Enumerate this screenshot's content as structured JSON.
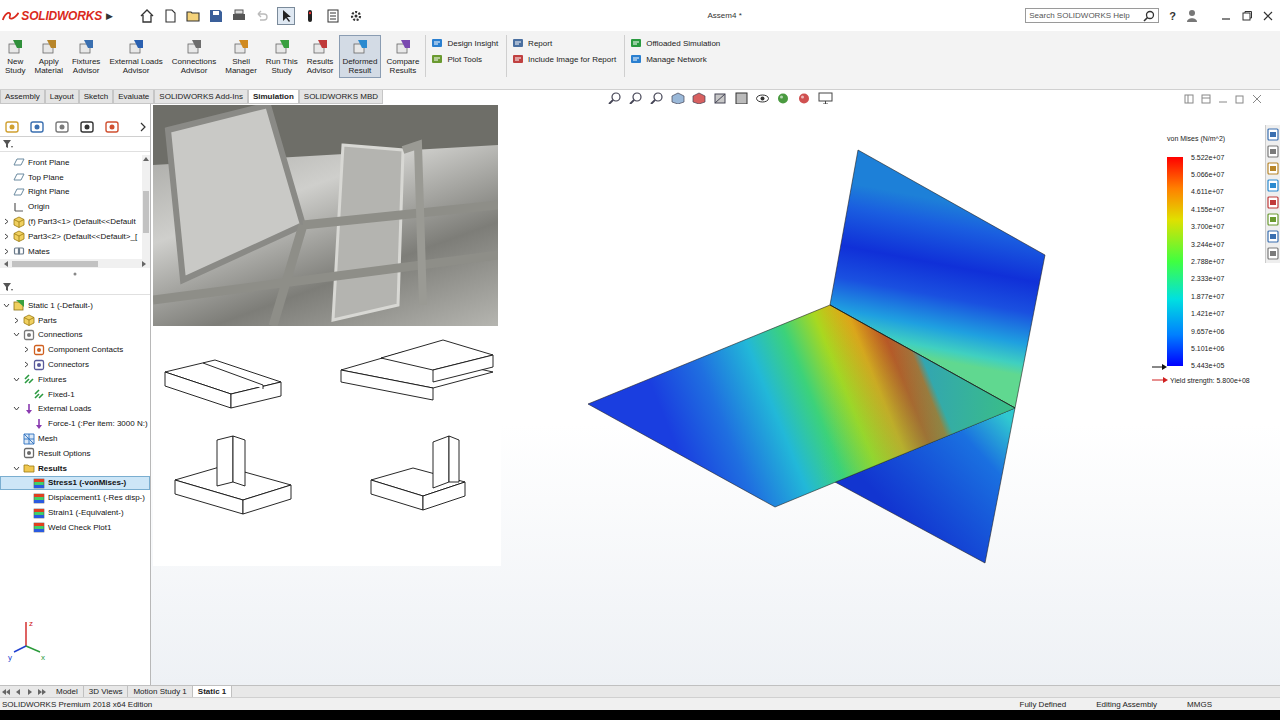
{
  "app": {
    "logo": "SOLIDWORKS",
    "menu_arrow": "▶",
    "title": "Assem4 *",
    "search": {
      "placeholder": "Search SOLIDWORKS Help"
    },
    "help": "?"
  },
  "ribbon": {
    "large_buttons": [
      {
        "lines": [
          "New",
          "Study"
        ],
        "selected": false
      },
      {
        "lines": [
          "Apply",
          "Material"
        ],
        "selected": false
      },
      {
        "lines": [
          "Fixtures",
          "Advisor"
        ],
        "selected": false
      },
      {
        "lines": [
          "External Loads",
          "Advisor"
        ],
        "selected": false
      },
      {
        "lines": [
          "Connections",
          "Advisor"
        ],
        "selected": false
      },
      {
        "lines": [
          "Shell",
          "Manager"
        ],
        "selected": false
      },
      {
        "lines": [
          "Run This",
          "Study"
        ],
        "selected": false
      },
      {
        "lines": [
          "Results",
          "Advisor"
        ],
        "selected": false
      },
      {
        "lines": [
          "Deformed",
          "Result"
        ],
        "selected": true
      },
      {
        "lines": [
          "Compare",
          "Results"
        ],
        "selected": false
      }
    ],
    "small_groups": [
      [
        "Design Insight",
        "Plot Tools"
      ],
      [
        "Report",
        "Include Image for Report"
      ],
      [
        "Offloaded Simulation",
        "Manage Network"
      ]
    ]
  },
  "tabs": [
    {
      "label": "Assembly",
      "selected": false
    },
    {
      "label": "Layout",
      "selected": false
    },
    {
      "label": "Sketch",
      "selected": false
    },
    {
      "label": "Evaluate",
      "selected": false
    },
    {
      "label": "SOLIDWORKS Add-Ins",
      "selected": false
    },
    {
      "label": "Simulation",
      "selected": true
    },
    {
      "label": "SOLIDWORKS MBD",
      "selected": false
    }
  ],
  "feature_tree": [
    {
      "label": "Front Plane",
      "kind": "plane",
      "expandable": false,
      "expanded": false
    },
    {
      "label": "Top Plane",
      "kind": "plane",
      "expandable": false,
      "expanded": false
    },
    {
      "label": "Right Plane",
      "kind": "plane",
      "expandable": false,
      "expanded": false
    },
    {
      "label": "Origin",
      "kind": "origin",
      "expandable": false,
      "expanded": false
    },
    {
      "label": "(f) Part3<1> (Default<<Default",
      "kind": "part",
      "expandable": true,
      "expanded": false
    },
    {
      "label": "Part3<2> (Default<<Default>_[",
      "kind": "part",
      "expandable": true,
      "expanded": false
    },
    {
      "label": "Mates",
      "kind": "mates",
      "expandable": true,
      "expanded": false
    }
  ],
  "sim_tree": [
    {
      "label": "Static 1 (-Default-)",
      "level": 0,
      "kind": "study",
      "expandable": true,
      "expanded": true,
      "selected": false,
      "bold": false
    },
    {
      "label": "Parts",
      "level": 1,
      "kind": "parts",
      "expandable": true,
      "expanded": false,
      "selected": false,
      "bold": false
    },
    {
      "label": "Connections",
      "level": 1,
      "kind": "connections",
      "expandable": true,
      "expanded": true,
      "selected": false,
      "bold": false
    },
    {
      "label": "Component Contacts",
      "level": 2,
      "kind": "contacts",
      "expandable": true,
      "expanded": false,
      "selected": false,
      "bold": false
    },
    {
      "label": "Connectors",
      "level": 2,
      "kind": "connectors",
      "expandable": true,
      "expanded": false,
      "selected": false,
      "bold": false
    },
    {
      "label": "Fixtures",
      "level": 1,
      "kind": "fixtures",
      "expandable": true,
      "expanded": true,
      "selected": false,
      "bold": false
    },
    {
      "label": "Fixed-1",
      "level": 2,
      "kind": "fixtures",
      "expandable": false,
      "expanded": false,
      "selected": false,
      "bold": false
    },
    {
      "label": "External Loads",
      "level": 1,
      "kind": "loads",
      "expandable": true,
      "expanded": true,
      "selected": false,
      "bold": false
    },
    {
      "label": "Force-1 (:Per item: 3000 N:)",
      "level": 2,
      "kind": "loads",
      "expandable": false,
      "expanded": false,
      "selected": false,
      "bold": false
    },
    {
      "label": "Mesh",
      "level": 1,
      "kind": "mesh",
      "expandable": false,
      "expanded": false,
      "selected": false,
      "bold": false
    },
    {
      "label": "Result Options",
      "level": 1,
      "kind": "options",
      "expandable": false,
      "expanded": false,
      "selected": false,
      "bold": false
    },
    {
      "label": "Results",
      "level": 1,
      "kind": "results",
      "expandable": true,
      "expanded": true,
      "selected": false,
      "bold": true
    },
    {
      "label": "Stress1 (-vonMises-)",
      "level": 2,
      "kind": "plot",
      "expandable": false,
      "expanded": false,
      "selected": true,
      "bold": true
    },
    {
      "label": "Displacement1 (-Res disp-)",
      "level": 2,
      "kind": "plot",
      "expandable": false,
      "expanded": false,
      "selected": false,
      "bold": false
    },
    {
      "label": "Strain1 (-Equivalent-)",
      "level": 2,
      "kind": "plot",
      "expandable": false,
      "expanded": false,
      "selected": false,
      "bold": false
    },
    {
      "label": "Weld Check Plot1",
      "level": 2,
      "kind": "plot",
      "expandable": false,
      "expanded": false,
      "selected": false,
      "bold": false
    }
  ],
  "legend": {
    "title": "von Mises (N/m^2)",
    "values": [
      "5.522e+07",
      "5.066e+07",
      "4.611e+07",
      "4.155e+07",
      "3.700e+07",
      "3.244e+07",
      "2.788e+07",
      "2.333e+07",
      "1.877e+07",
      "1.421e+07",
      "9.657e+06",
      "5.101e+06",
      "5.443e+05"
    ],
    "yield": "Yield strength: 5.800e+08"
  },
  "triad": {
    "x": "x",
    "y": "y",
    "z": "z"
  },
  "bottom_tabs": [
    {
      "label": "Model",
      "selected": false
    },
    {
      "label": "3D Views",
      "selected": false
    },
    {
      "label": "Motion Study 1",
      "selected": false
    },
    {
      "label": "Static 1",
      "selected": true
    }
  ],
  "status_bar": {
    "left": "SOLIDWORKS Premium 2018 x64 Edition",
    "right": [
      "Fully Defined",
      "Editing Assembly",
      "MMGS"
    ]
  }
}
